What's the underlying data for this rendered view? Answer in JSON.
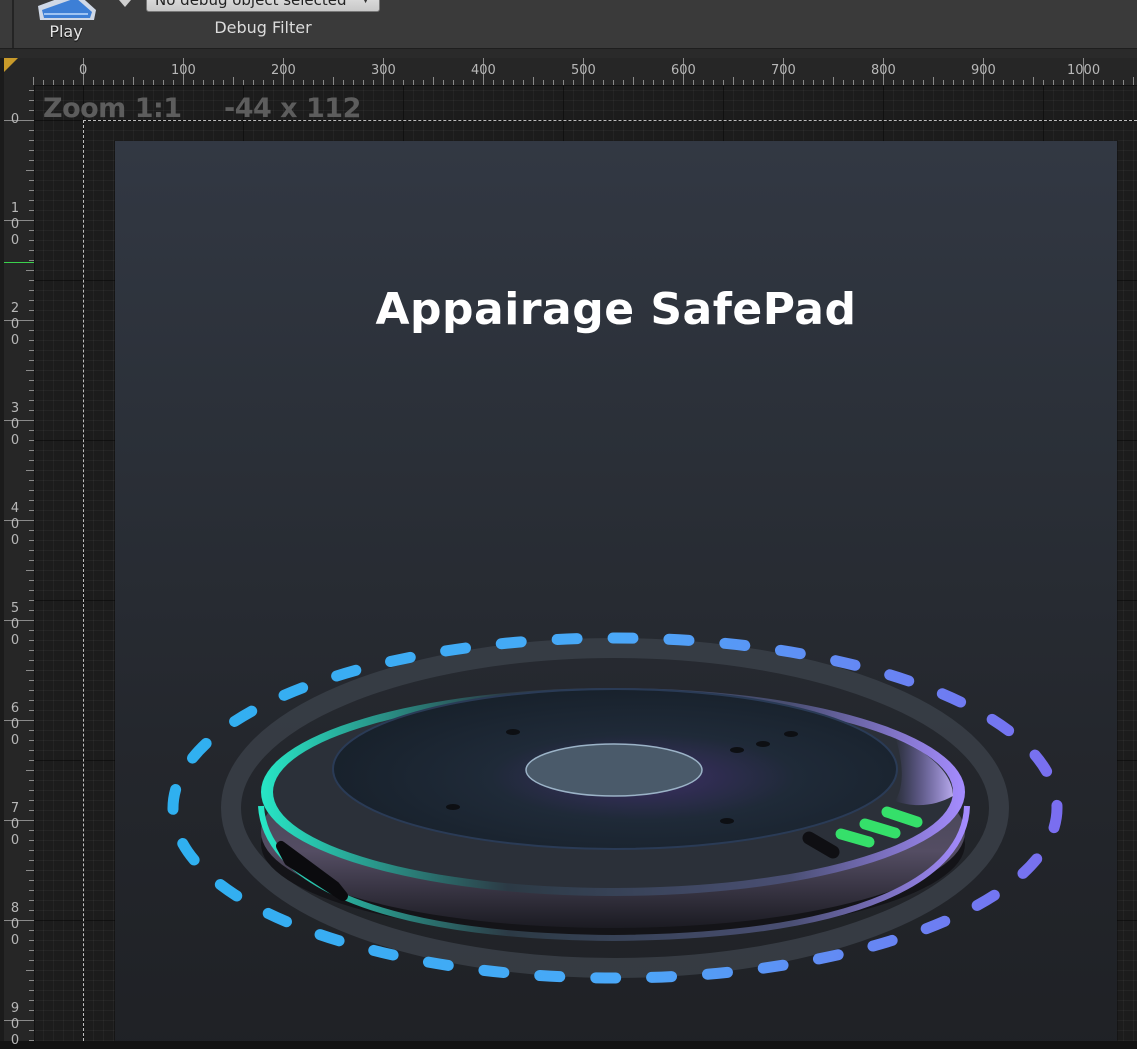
{
  "toolbar": {
    "play_label": "Play",
    "debug_select_value": "No debug object selected",
    "debug_filter_label": "Debug Filter"
  },
  "rulers": {
    "top_labels": [
      "0",
      "100",
      "200",
      "300",
      "400",
      "500",
      "600",
      "700",
      "800",
      "900",
      "1000"
    ],
    "left_labels": [
      [
        "0"
      ],
      [
        "1",
        "0",
        "0"
      ],
      [
        "2",
        "0",
        "0"
      ],
      [
        "3",
        "0",
        "0"
      ],
      [
        "4",
        "0",
        "0"
      ],
      [
        "5",
        "0",
        "0"
      ],
      [
        "6",
        "0",
        "0"
      ],
      [
        "7",
        "0",
        "0"
      ],
      [
        "8",
        "0",
        "0"
      ],
      [
        "9",
        "0",
        "0"
      ]
    ]
  },
  "canvas": {
    "zoom_label": "Zoom 1:1",
    "resolution_label": "-44 x 112",
    "title": "Appairage SafePad"
  },
  "colors": {
    "ring_dash_start": "#2fb0f0",
    "ring_dash_end": "#7a6ef0",
    "device_accent_teal": "#2fe3c8",
    "device_accent_purple": "#9a86ff",
    "indicator_green": "#35e06a"
  }
}
